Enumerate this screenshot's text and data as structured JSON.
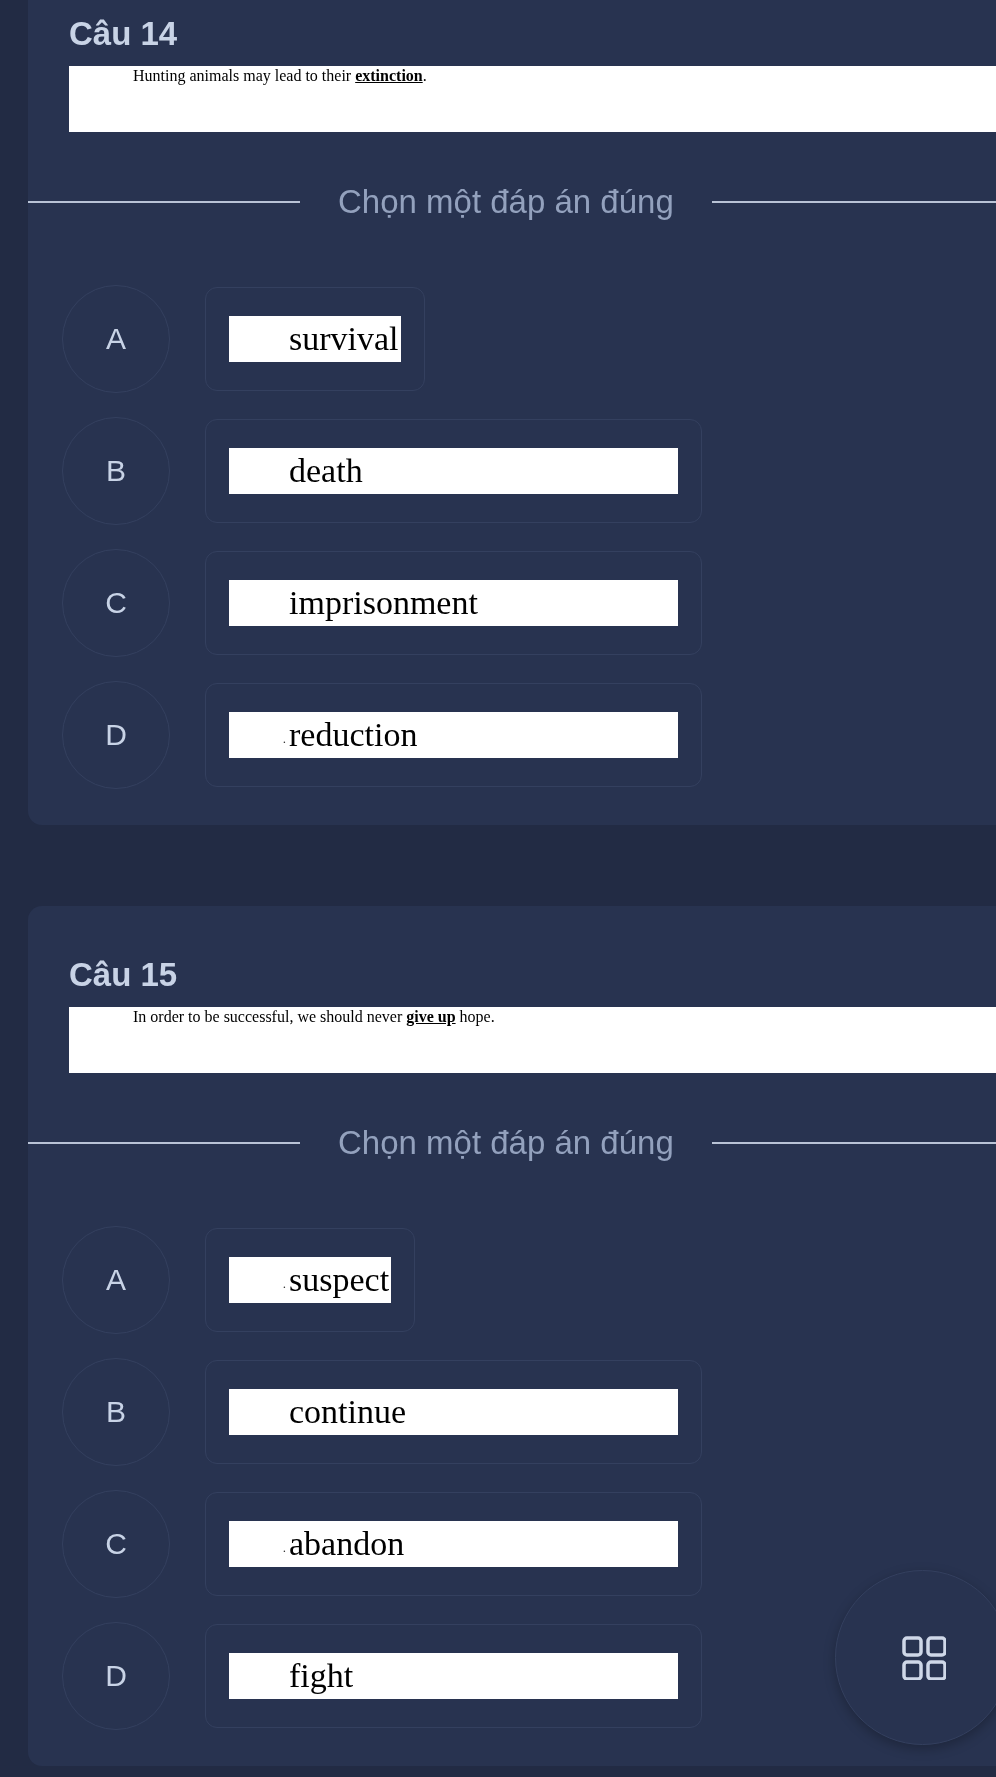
{
  "questions": [
    {
      "title": "Câu 14",
      "prompt": "Hunting animals may lead to their **extinction**.",
      "instruction": "Chọn một đáp án đúng",
      "options": [
        {
          "letter": "A",
          "text": "survival",
          "compact": true
        },
        {
          "letter": "B",
          "text": "death",
          "compact": false
        },
        {
          "letter": "C",
          "text": "imprisonment",
          "compact": false
        },
        {
          "letter": "D",
          "prefix": ".",
          "text": "reduction",
          "compact": false
        }
      ]
    },
    {
      "title": "Câu 15",
      "prompt": "In order to be successful, we should never **give up** hope.",
      "instruction": "Chọn một đáp án đúng",
      "options": [
        {
          "letter": "A",
          "prefix": ".",
          "text": "suspect",
          "compact": true
        },
        {
          "letter": "B",
          "text": "continue",
          "compact": false
        },
        {
          "letter": "C",
          "prefix": ".",
          "text": "abandon",
          "compact": false
        },
        {
          "letter": "D",
          "text": "fight",
          "compact": false
        }
      ]
    }
  ]
}
